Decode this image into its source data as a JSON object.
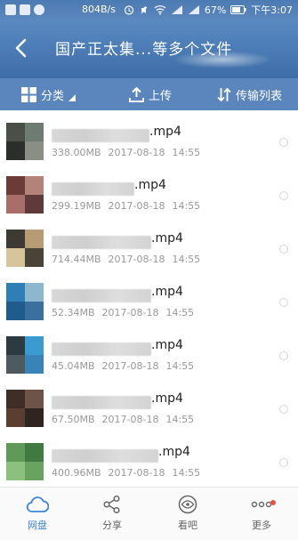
{
  "status_bar": {
    "speed": "804B/s",
    "battery": "67%",
    "time": "下午3:07"
  },
  "header": {
    "title": "国产正太集...等多个文件"
  },
  "toolbar": {
    "category_label": "分类",
    "upload_label": "上传",
    "transfer_label": "传输列表"
  },
  "files": [
    {
      "ext": ".mp4",
      "size": "338.00MB",
      "date": "2017-08-18",
      "time": "14:55",
      "thumb": [
        "#4a4f47",
        "#6d7b72",
        "#2b2e2b",
        "#8a8f86"
      ]
    },
    {
      "ext": ".mp4",
      "size": "299.19MB",
      "date": "2017-08-18",
      "time": "14:55",
      "thumb": [
        "#6b3c37",
        "#b38379",
        "#a76e6a",
        "#5e3a3a"
      ]
    },
    {
      "ext": ".mp4",
      "size": "714.44MB",
      "date": "2017-08-18",
      "time": "14:55",
      "thumb": [
        "#3c3a33",
        "#b79c73",
        "#d8c49a",
        "#4a4438"
      ]
    },
    {
      "ext": ".mp4",
      "size": "52.34MB",
      "date": "2017-08-18",
      "time": "14:55",
      "thumb": [
        "#2f7fb6",
        "#8fb6cf",
        "#1f5c8b",
        "#3b6fa0"
      ]
    },
    {
      "ext": ".mp4",
      "size": "45.04MB",
      "date": "2017-08-18",
      "time": "14:55",
      "thumb": [
        "#2c3b40",
        "#3b9ad0",
        "#4d5b60",
        "#3a83b8"
      ]
    },
    {
      "ext": ".mp4",
      "size": "67.50MB",
      "date": "2017-08-18",
      "time": "14:55",
      "thumb": [
        "#3e2e27",
        "#6e5447",
        "#5a3f31",
        "#2f241f"
      ]
    },
    {
      "ext": ".mp4",
      "size": "400.96MB",
      "date": "2017-08-18",
      "time": "14:55",
      "thumb": [
        "#5f9a58",
        "#3f7a41",
        "#8cc07d",
        "#6aa361"
      ]
    }
  ],
  "bottom_nav": [
    {
      "label": "网盘",
      "icon": "cloud-icon",
      "active": true
    },
    {
      "label": "分享",
      "icon": "share-icon",
      "active": false
    },
    {
      "label": "看吧",
      "icon": "eye-icon",
      "active": false
    },
    {
      "label": "更多",
      "icon": "more-icon",
      "active": false
    }
  ],
  "colors": {
    "header_blue": "#4f7fb8",
    "toolbar_blue": "#5a86bd",
    "active_nav": "#3d87d8",
    "badge_red": "#e8533f"
  }
}
